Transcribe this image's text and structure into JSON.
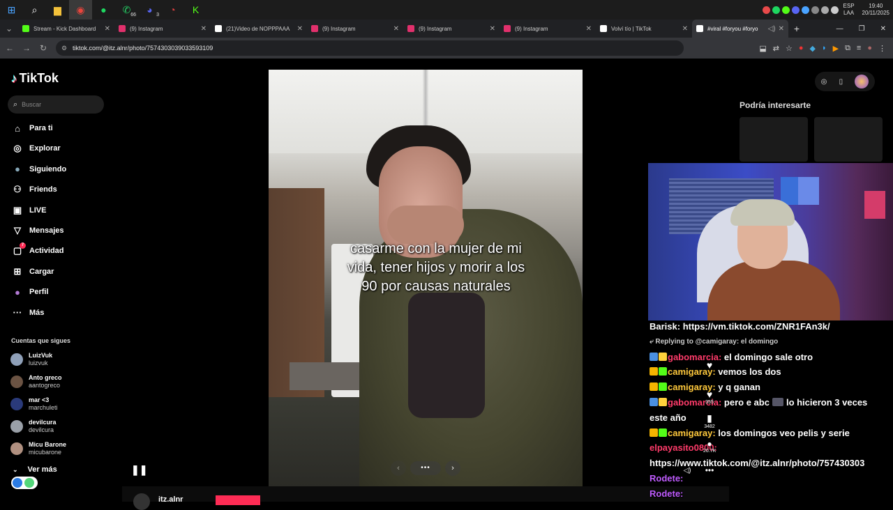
{
  "taskbar": {
    "apps": [
      {
        "name": "windows-start-icon",
        "glyph": "⊞",
        "color": "#4aa3ff"
      },
      {
        "name": "search-icon",
        "glyph": "⌕",
        "color": "#ffffff"
      },
      {
        "name": "file-explorer-icon",
        "glyph": "▆",
        "color": "#f3c13a"
      },
      {
        "name": "chrome-icon",
        "glyph": "◉",
        "color": "#e8453c"
      },
      {
        "name": "spotify-icon",
        "glyph": "●",
        "color": "#1ed760"
      },
      {
        "name": "whatsapp-icon",
        "glyph": "✆",
        "color": "#25d366",
        "badge": "66"
      },
      {
        "name": "discord-icon",
        "glyph": "◕",
        "color": "#5865f2",
        "badge": "3"
      },
      {
        "name": "obs-icon",
        "glyph": "◔",
        "color": "#e14141"
      },
      {
        "name": "kick-icon",
        "glyph": "K",
        "color": "#53fc18"
      }
    ],
    "tray": {
      "lang_top": "ESP",
      "lang_bottom": "LAA",
      "time": "19:40",
      "date": "20/11/2025"
    }
  },
  "tabs": [
    {
      "title": "Stream - Kick Dashboard",
      "icon": "kick-icon",
      "color": "#53fc18"
    },
    {
      "title": "(9) Instagram",
      "icon": "instagram-icon",
      "color": "#e1306c"
    },
    {
      "title": "(21)Video de NOPPPAAA",
      "icon": "tiktok-icon",
      "color": "#ffffff"
    },
    {
      "title": "(9) Instagram",
      "icon": "instagram-icon",
      "color": "#e1306c"
    },
    {
      "title": "(9) Instagram",
      "icon": "instagram-icon",
      "color": "#e1306c"
    },
    {
      "title": "(9) Instagram",
      "icon": "instagram-icon",
      "color": "#e1306c"
    },
    {
      "title": "Volví tío | TikTok",
      "icon": "tiktok-icon",
      "color": "#ffffff"
    },
    {
      "title": "#viral #foryou #foryo",
      "icon": "tiktok-icon",
      "color": "#ffffff",
      "active": true
    }
  ],
  "address": {
    "url": "tiktok.com/@itz.alnr/photo/7574303039033593109"
  },
  "tiktok": {
    "logo_text": "TikTok",
    "search_placeholder": "Buscar",
    "nav": [
      {
        "label": "Para ti",
        "icon": "home-icon",
        "glyph": "⌂"
      },
      {
        "label": "Explorar",
        "icon": "compass-icon",
        "glyph": "◎"
      },
      {
        "label": "Siguiendo",
        "icon": "following-avatar-icon",
        "glyph": "●"
      },
      {
        "label": "Friends",
        "icon": "friends-icon",
        "glyph": "⚇"
      },
      {
        "label": "LIVE",
        "icon": "live-icon",
        "glyph": "▣"
      },
      {
        "label": "Mensajes",
        "icon": "messages-icon",
        "glyph": "▽"
      },
      {
        "label": "Actividad",
        "icon": "activity-icon",
        "glyph": "▢",
        "badge": "7"
      },
      {
        "label": "Cargar",
        "icon": "upload-icon",
        "glyph": "⊞"
      },
      {
        "label": "Perfil",
        "icon": "profile-avatar-icon",
        "glyph": "●"
      },
      {
        "label": "Más",
        "icon": "more-icon",
        "glyph": "···"
      }
    ],
    "following_header": "Cuentas que sigues",
    "following": [
      {
        "name": "LuizVuk",
        "handle": "luizvuk",
        "color": "#8fa0b8"
      },
      {
        "name": "Anto greco",
        "handle": "aantogreco",
        "color": "#6b5343"
      },
      {
        "name": "mar <3",
        "handle": "marchuleti",
        "color": "#2a3a7a"
      },
      {
        "name": "devilcura",
        "handle": "devilcura",
        "color": "#9aa0a8"
      },
      {
        "name": "Micu Barone",
        "handle": "micubarone",
        "color": "#b09080"
      }
    ],
    "ver_mas": "Ver más",
    "caption": "casarme con la mujer de mi vida, tener hijos y morir a los 90 por causas naturales",
    "pager_dots": "•••",
    "author": "itz.alnr",
    "recommend_title": "Podría interesarte"
  },
  "side_actions": {
    "comments": "3482",
    "saves": "20.7K",
    "likes": "355"
  },
  "chat": [
    {
      "user": "Barisk:",
      "color": "#ffffff",
      "text": "https://vm.tiktok.com/ZNR1FAn3k/"
    },
    {
      "reply": "⤶ Replying to @camigaray: el domingo"
    },
    {
      "user": "gabomarcia:",
      "color": "#ff3b6a",
      "text": "el domingo sale otro",
      "badges": [
        "#4a8fe0",
        "#ffd23c"
      ]
    },
    {
      "user": "camigaray:",
      "color": "#ffc93c",
      "text": "vemos los dos",
      "badges": [
        "#f5b400",
        "#53fc18"
      ]
    },
    {
      "user": "camigaray:",
      "color": "#ffc93c",
      "text": "y q ganan",
      "badges": [
        "#f5b400",
        "#53fc18"
      ]
    },
    {
      "user": "gabomarcia:",
      "color": "#ff3b6a",
      "text": "pero e abc",
      "text2": "lo hicieron 3 veces",
      "badges": [
        "#4a8fe0",
        "#ffd23c"
      ]
    },
    {
      "cont": "este año"
    },
    {
      "user": "camigaray:",
      "color": "#ffc93c",
      "text": "los domingos veo pelis y serie",
      "badges": [
        "#f5b400",
        "#53fc18"
      ]
    },
    {
      "user": "elpayasito0800:",
      "color": "#ff3b6a",
      "text": ""
    },
    {
      "cont": "https://www.tiktok.com/@itz.alnr/photo/757430303"
    },
    {
      "user": "Rodete:",
      "color": "#c05cff",
      "text": ""
    },
    {
      "user": "Rodete:",
      "color": "#c05cff",
      "text": ""
    }
  ]
}
